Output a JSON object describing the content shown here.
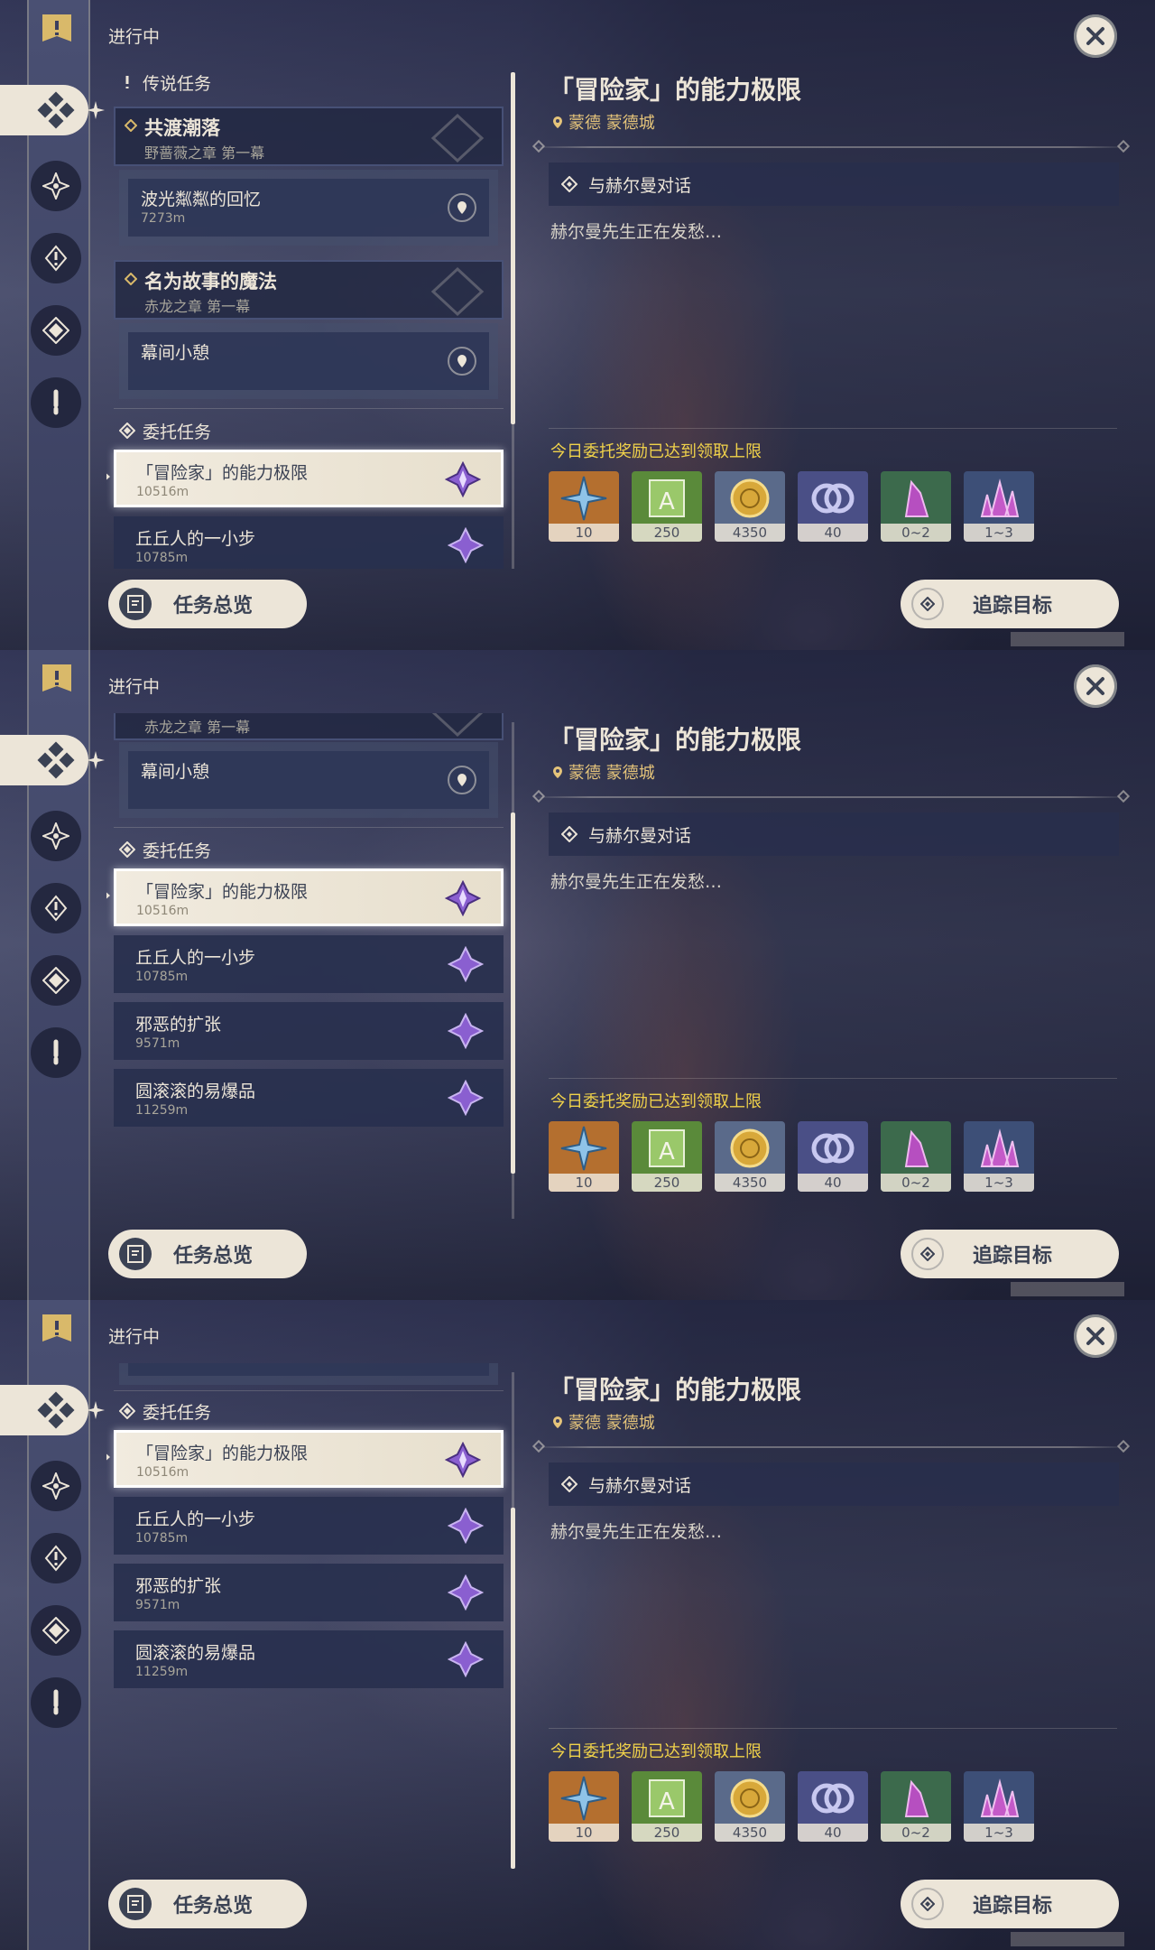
{
  "status_title": "进行中",
  "legend_section": "传说任务",
  "commission_section": "委托任务",
  "chapters": [
    {
      "title": "共渡潮落",
      "subtitle": "野蔷薇之章 第一幕",
      "subquest": {
        "title": "波光粼粼的回忆",
        "distance": "7273m"
      }
    },
    {
      "title": "名为故事的魔法",
      "subtitle": "赤龙之章 第一幕",
      "subquest": {
        "title": "幕间小憩",
        "distance": ""
      }
    }
  ],
  "commissions": [
    {
      "title": "「冒险家」的能力极限",
      "distance": "10516m"
    },
    {
      "title": "丘丘人的一小步",
      "distance": "10785m"
    },
    {
      "title": "邪恶的扩张",
      "distance": "9571m"
    },
    {
      "title": "圆滚滚的易爆品",
      "distance": "11259m"
    }
  ],
  "detail": {
    "title": "「冒险家」的能力极限",
    "location": "蒙德 蒙德城",
    "objective": "与赫尔曼对话",
    "description": "赫尔曼先生正在发愁…",
    "reward_note": "今日委托奖励已达到领取上限",
    "rewards": [
      {
        "icon": "intertwined-fate-icon",
        "count": "10",
        "bg": "#b46f2f"
      },
      {
        "icon": "adventure-exp-icon",
        "count": "250",
        "bg": "#5a8a3a"
      },
      {
        "icon": "mora-icon",
        "count": "4350",
        "bg": "#5a6a8a"
      },
      {
        "icon": "companionship-exp-icon",
        "count": "40",
        "bg": "#4a4f86"
      },
      {
        "icon": "crystal-chunk-icon",
        "count": "0~2",
        "bg": "#3c6a4c"
      },
      {
        "icon": "crystal-cluster-icon",
        "count": "1~3",
        "bg": "#3d4f77"
      }
    ]
  },
  "buttons": {
    "overview": "任务总览",
    "track": "追踪目标"
  }
}
